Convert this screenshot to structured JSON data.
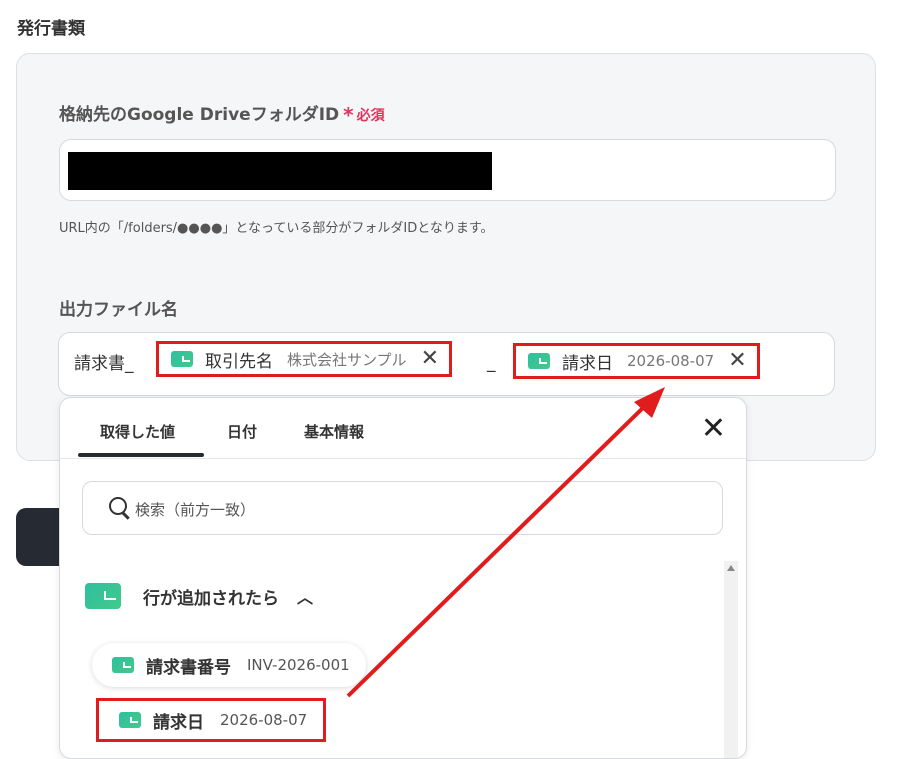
{
  "section_title": "発行書類",
  "folder_field": {
    "label": "格納先のGoogle DriveフォルダID",
    "required_mark": "*",
    "required_text": "必須",
    "hint": "URL内の「/folders/●●●●」となっている部分がフォルダIDとなります。"
  },
  "filename_field": {
    "label": "出力ファイル名",
    "prefix": "請求書_",
    "separator": "_",
    "chips": [
      {
        "label": "取引先名",
        "value": "株式会社サンプル"
      },
      {
        "label": "請求日",
        "value": "2026-08-07"
      }
    ]
  },
  "dropdown": {
    "tabs": [
      "取得した値",
      "日付",
      "基本情報"
    ],
    "active_tab": "取得した値",
    "search_placeholder": "検索（前方一致）",
    "group_label": "行が追加されたら",
    "items": [
      {
        "label": "請求書番号",
        "value": "INV-2026-001"
      },
      {
        "label": "請求日",
        "value": "2026-08-07"
      }
    ]
  },
  "colors": {
    "highlight": "#e01c1c",
    "required": "#e0335b",
    "panel_bg": "#f5f6f8",
    "dark_button": "#262b33"
  }
}
